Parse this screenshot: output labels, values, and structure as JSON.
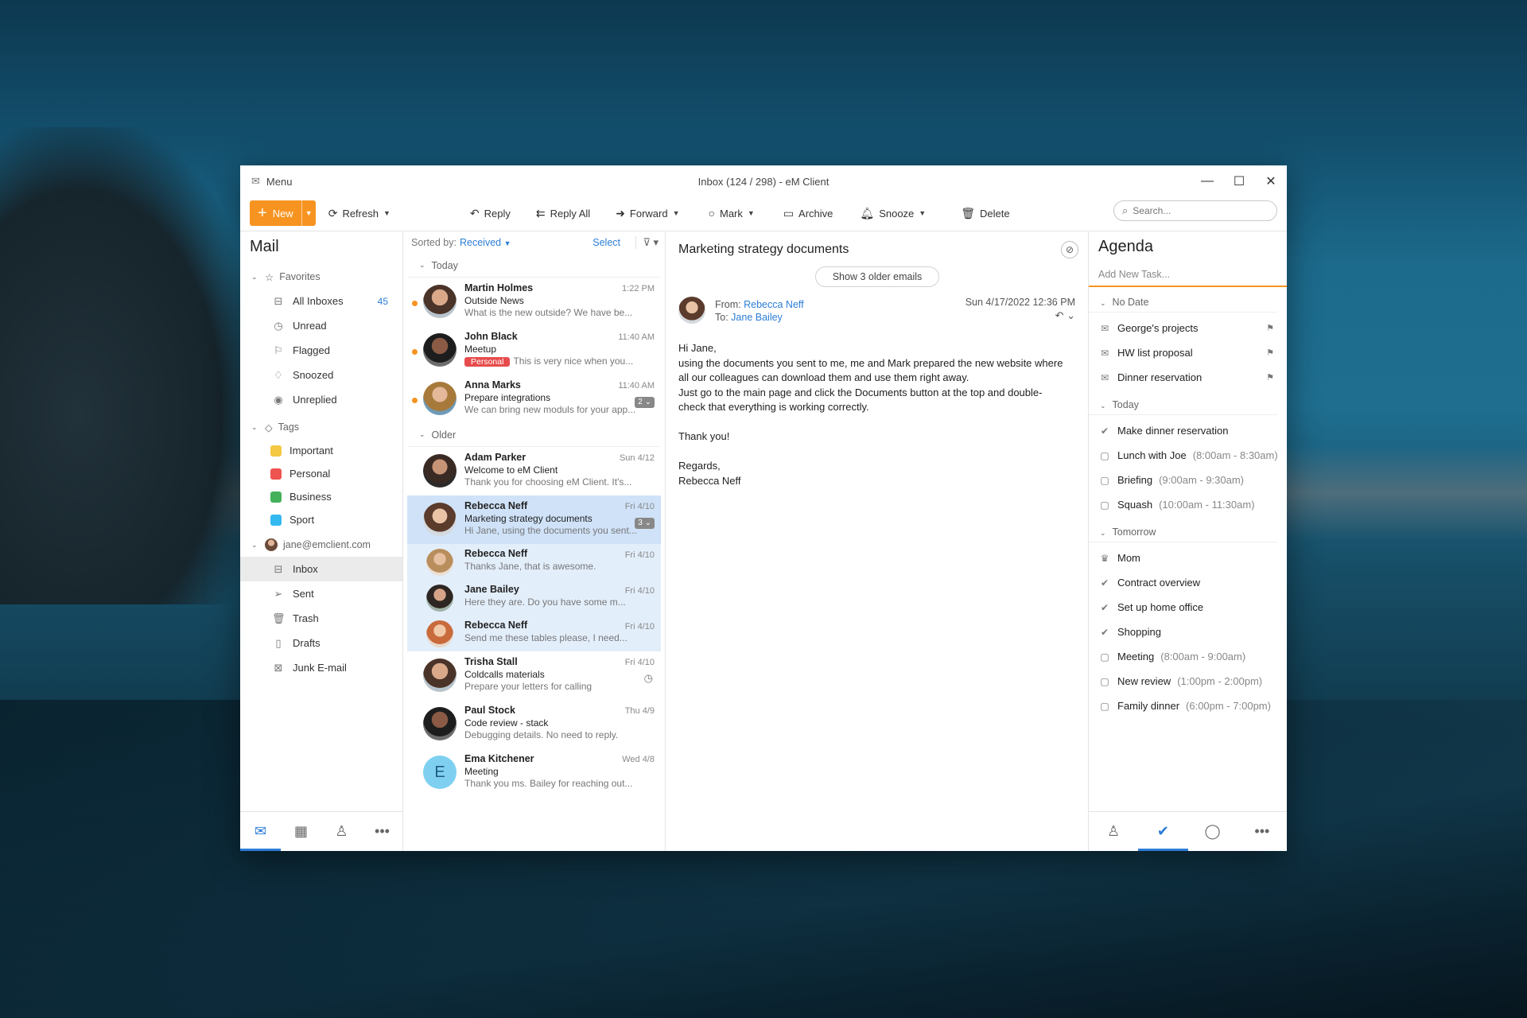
{
  "window": {
    "title": "Inbox (124 / 298) - eM Client",
    "menu_label": "Menu"
  },
  "toolbar": {
    "new_label": "New",
    "refresh_label": "Refresh",
    "reply_label": "Reply",
    "reply_all_label": "Reply All",
    "forward_label": "Forward",
    "mark_label": "Mark",
    "archive_label": "Archive",
    "snooze_label": "Snooze",
    "delete_label": "Delete",
    "search_placeholder": "Search..."
  },
  "sidebar": {
    "title": "Mail",
    "favorites_label": "Favorites",
    "favorites": [
      {
        "label": "All Inboxes",
        "count": "45",
        "icon": "inbox-icon"
      },
      {
        "label": "Unread",
        "icon": "clock-icon"
      },
      {
        "label": "Flagged",
        "icon": "flag-icon"
      },
      {
        "label": "Snoozed",
        "icon": "bell-icon"
      },
      {
        "label": "Unreplied",
        "icon": "eye-icon"
      }
    ],
    "tags_label": "Tags",
    "tags": [
      {
        "label": "Important",
        "color": "#f5c842"
      },
      {
        "label": "Personal",
        "color": "#ef5350"
      },
      {
        "label": "Business",
        "color": "#43b15a"
      },
      {
        "label": "Sport",
        "color": "#33b8ef"
      }
    ],
    "account_label": "jane@emclient.com",
    "folders": [
      {
        "label": "Inbox",
        "icon": "inbox-icon"
      },
      {
        "label": "Sent",
        "icon": "send-icon"
      },
      {
        "label": "Trash",
        "icon": "trash-icon"
      },
      {
        "label": "Drafts",
        "icon": "draft-icon"
      },
      {
        "label": "Junk E-mail",
        "icon": "junk-icon"
      }
    ]
  },
  "list": {
    "sorted_label": "Sorted by:",
    "sorted_value": "Received",
    "select_label": "Select",
    "group_today": "Today",
    "group_older": "Older",
    "today": [
      {
        "from": "Martin Holmes",
        "subject": "Outside News",
        "preview": "What is the new outside? We have be...",
        "time": "1:22 PM",
        "unread": true
      },
      {
        "from": "John Black",
        "subject": "Meetup",
        "tag": "Personal",
        "preview": "This is very nice when you...",
        "time": "11:40 AM",
        "unread": true
      },
      {
        "from": "Anna Marks",
        "subject": "Prepare integrations",
        "preview": "We can bring new moduls for your app...",
        "time": "11:40 AM",
        "unread": true,
        "count": "2"
      }
    ],
    "older": [
      {
        "from": "Adam Parker",
        "subject": "Welcome to eM Client",
        "preview": "Thank you for choosing eM Client. It's...",
        "time": "Sun 4/12"
      },
      {
        "from": "Rebecca Neff",
        "subject": "Marketing strategy documents",
        "preview": "Hi Jane, using the documents you sent...",
        "time": "Fri 4/10",
        "count": "3"
      }
    ],
    "thread": [
      {
        "from": "Rebecca Neff",
        "preview": "Thanks Jane, that is awesome.",
        "time": "Fri 4/10"
      },
      {
        "from": "Jane Bailey",
        "preview": "Here they are. Do you have some m...",
        "time": "Fri 4/10"
      },
      {
        "from": "Rebecca Neff",
        "preview": "Send me these tables please, I need...",
        "time": "Fri 4/10"
      }
    ],
    "rest": [
      {
        "from": "Trisha Stall",
        "subject": "Coldcalls materials",
        "preview": "Prepare your letters for calling",
        "time": "Fri 4/10"
      },
      {
        "from": "Paul Stock",
        "subject": "Code review - stack",
        "preview": "Debugging details. No need to reply.",
        "time": "Thu 4/9"
      },
      {
        "from": "Ema Kitchener",
        "subject": "Meeting",
        "preview": "Thank you ms. Bailey for reaching out...",
        "time": "Wed 4/8",
        "initial": "E"
      }
    ]
  },
  "reader": {
    "subject": "Marketing strategy documents",
    "older_button": "Show 3 older emails",
    "from_label": "From:",
    "from_name": "Rebecca Neff",
    "to_label": "To:",
    "to_name": "Jane Bailey",
    "date": "Sun 4/17/2022 12:36 PM",
    "body": "Hi Jane,\nusing the documents you sent to me, me and Mark prepared the new website where\nall our colleagues can download them and use them right away.\nJust go to the main page and click the Documents button at the top and double-\ncheck that everything is working correctly.\n\nThank you!\n\nRegards,\nRebecca Neff"
  },
  "agenda": {
    "title": "Agenda",
    "add_placeholder": "Add New Task...",
    "groups": [
      {
        "label": "No Date",
        "items": [
          {
            "label": "George's projects",
            "icon": "envelope",
            "flag": true
          },
          {
            "label": "HW list proposal",
            "icon": "envelope",
            "flag": true
          },
          {
            "label": "Dinner reservation",
            "icon": "envelope",
            "flag": true
          }
        ]
      },
      {
        "label": "Today",
        "items": [
          {
            "label": "Make dinner reservation",
            "icon": "check"
          },
          {
            "label": "Lunch with Joe",
            "time": "(8:00am - 8:30am)",
            "icon": "calendar"
          },
          {
            "label": "Briefing",
            "time": "(9:00am - 9:30am)",
            "icon": "calendar"
          },
          {
            "label": "Squash",
            "time": "(10:00am - 11:30am)",
            "icon": "calendar"
          }
        ]
      },
      {
        "label": "Tomorrow",
        "items": [
          {
            "label": "Mom",
            "icon": "cake"
          },
          {
            "label": "Contract overview",
            "icon": "check"
          },
          {
            "label": "Set up home office",
            "icon": "check"
          },
          {
            "label": "Shopping",
            "icon": "check"
          },
          {
            "label": "Meeting",
            "time": "(8:00am - 9:00am)",
            "icon": "calendar"
          },
          {
            "label": "New review",
            "time": "(1:00pm - 2:00pm)",
            "icon": "calendar"
          },
          {
            "label": "Family dinner",
            "time": "(6:00pm - 7:00pm)",
            "icon": "calendar"
          }
        ]
      }
    ]
  },
  "colors": {
    "accent": "#f79421",
    "link": "#2c7dd6",
    "selected": "#cfe2f8"
  }
}
